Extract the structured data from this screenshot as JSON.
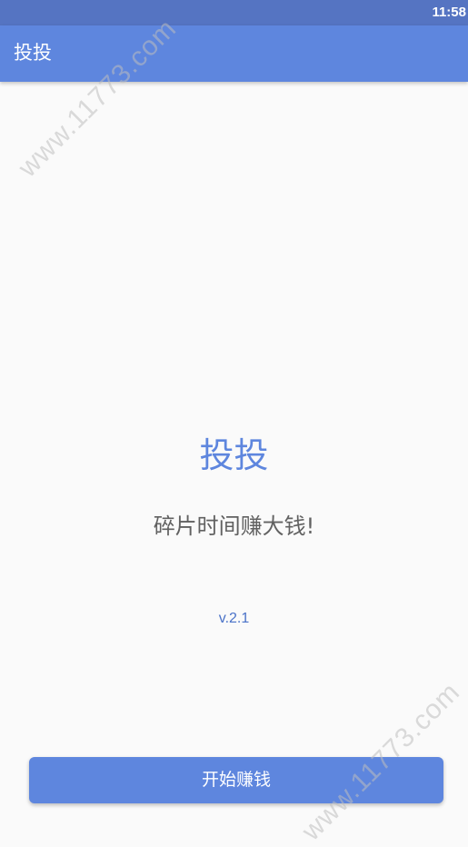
{
  "status_bar": {
    "time": "11:58"
  },
  "app_bar": {
    "title": "投投"
  },
  "splash": {
    "app_name": "投投",
    "slogan": "碎片时间赚大钱!",
    "version": "v.2.1"
  },
  "start_button": {
    "label": "开始赚钱"
  },
  "watermark": {
    "text": "www.11773.com"
  },
  "colors": {
    "primary": "#5e86de",
    "status_bar": "#5574c2",
    "background": "#fafafa",
    "slogan_text": "#616161",
    "version_text": "#4a72c8"
  }
}
